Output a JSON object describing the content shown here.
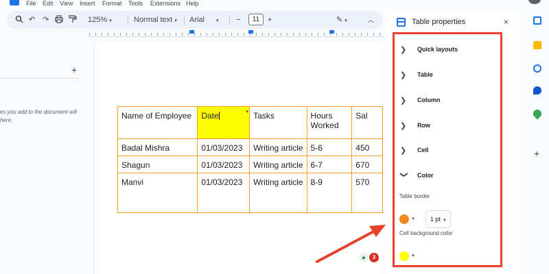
{
  "menu": [
    "File",
    "Edit",
    "View",
    "Insert",
    "Format",
    "Tools",
    "Extensions",
    "Help"
  ],
  "toolbar": {
    "search_icon": "search-icon",
    "undo_icon": "undo-icon",
    "redo_icon": "redo-icon",
    "print_icon": "print-icon",
    "paint_format_icon": "paint-format-icon",
    "zoom": "125%",
    "style": "Normal text",
    "font": "Arial",
    "minus": "−",
    "font_size": "11",
    "plus": "+"
  },
  "outline": {
    "hint": "es you add to the document will here."
  },
  "table": {
    "headers": [
      "Name of Employee",
      "Date",
      "Tasks",
      "Hours Worked",
      "Sal"
    ],
    "rows": [
      [
        "Badal Mishra",
        "01/03/2023",
        "Writing article",
        "5-6",
        "450"
      ],
      [
        "Shagun",
        "01/03/2023",
        "Writing article",
        "6-7",
        "670"
      ],
      [
        "Manvi",
        "01/03/2023",
        "Writing article",
        "8-9",
        "570"
      ]
    ]
  },
  "panel": {
    "title": "Table properties",
    "close": "×",
    "sections": [
      "Quick layouts",
      "Table",
      "Column",
      "Row",
      "Cell",
      "Color"
    ],
    "table_border_label": "Table border",
    "border_width": "1 pt",
    "cell_bg_label": "Cell background color"
  },
  "colors": {
    "border_orange": "#f4a11d",
    "cell_yellow": "#ffff00",
    "highlight_red": "#e8412c",
    "accent_blue": "#1a73e8"
  },
  "comment_badge_count": "3"
}
